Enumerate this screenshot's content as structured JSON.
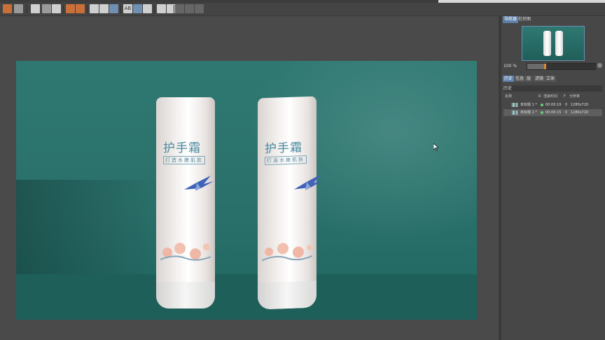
{
  "app": {
    "accent": "#5c7fa8",
    "render_bg": "#2a706a"
  },
  "toolbar": {
    "buttons": [
      "open-icon",
      "save-icon",
      "render-settings-icon",
      "render-view-icon",
      "color-pick-icon",
      "aspect-icon",
      "clear-icon",
      "region-icon",
      "compare-icon",
      "alpha-icon",
      "snapshot-icon",
      "fit-icon",
      "zoom-icon",
      "image-icon",
      "toggle-icon"
    ],
    "ab_label": "AB"
  },
  "product": {
    "brand": "护手霜",
    "tagline": "打造水嫩肌肤"
  },
  "panel": {
    "tabs": [
      "导航器",
      "柱状图"
    ],
    "zoom_label": "100 %",
    "zoom_fraction": 0.25,
    "history_tabs": [
      "历史",
      "信息",
      "层",
      "滤镜",
      "立体"
    ],
    "history_title": "历史",
    "columns": {
      "name": "名称",
      "r": "R",
      "render_time": "渲染时间",
      "f": "F",
      "resolution": "分辨率"
    },
    "rows": [
      {
        "name": "未标题 1 *",
        "render_time": "00:00:19",
        "f": "0",
        "resolution": "1280x720",
        "selected": false
      },
      {
        "name": "未标题 1 *",
        "render_time": "00:00:15",
        "f": "0",
        "resolution": "1280x720",
        "selected": true
      }
    ]
  }
}
